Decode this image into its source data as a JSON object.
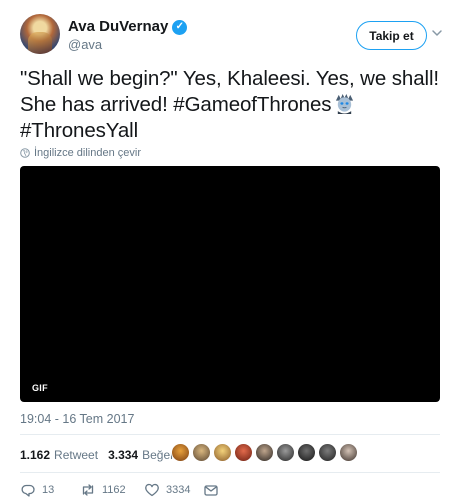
{
  "author": {
    "display_name": "Ava DuVernay",
    "handle": "@ava",
    "verified_icon": "verified-badge-icon",
    "follow_label": "Takip et"
  },
  "tweet": {
    "text_part1": "\"Shall we begin?\" Yes, Khaleesi. Yes, we shall! She has arrived! ",
    "hashtag1": "#GameofThrones",
    "hashtag2": "#ThronesYall",
    "emoji": "night-king-emoji-icon",
    "translate_label": "İngilizce dilinden çevir"
  },
  "media": {
    "badge": "GIF"
  },
  "timestamp": "19:04 - 16 Tem 2017",
  "stats": {
    "retweets_count": "1.162",
    "retweets_label": "Retweet",
    "likes_count": "3.334",
    "likes_label": "Beğeni"
  },
  "actions": {
    "reply_count": "13",
    "retweet_count": "1162",
    "like_count": "3334"
  },
  "colors": {
    "accent": "#1da1f2",
    "muted": "#657786",
    "text": "#14171a"
  }
}
